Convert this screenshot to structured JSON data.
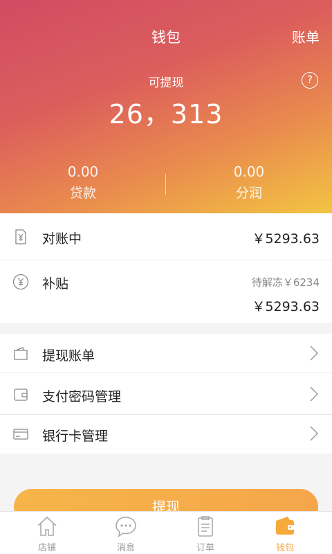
{
  "header": {
    "title": "钱包",
    "bill_link": "账单",
    "help_symbol": "?"
  },
  "balance": {
    "label": "可提现",
    "value": "26，313"
  },
  "stats": [
    {
      "value": "0.00",
      "label": "贷款"
    },
    {
      "value": "0.00",
      "label": "分润"
    }
  ],
  "reconciling": {
    "label": "对账中",
    "amount": "￥5293.63",
    "icon": "receipt-yen-icon"
  },
  "subsidy": {
    "label": "补贴",
    "frozen": "待解冻￥6234",
    "amount": "￥5293.63",
    "icon": "yen-circle-icon"
  },
  "menu": [
    {
      "label": "提现账单",
      "icon": "wallet-icon"
    },
    {
      "label": "支付密码管理",
      "icon": "wallet-card-icon"
    },
    {
      "label": "银行卡管理",
      "icon": "bank-card-icon"
    }
  ],
  "withdraw_button": "提现",
  "tabs": [
    {
      "label": "店铺",
      "icon": "store-icon",
      "active": false
    },
    {
      "label": "消息",
      "icon": "message-icon",
      "active": false
    },
    {
      "label": "订单",
      "icon": "order-icon",
      "active": false
    },
    {
      "label": "钱包",
      "icon": "wallet-icon",
      "active": true
    }
  ],
  "colors": {
    "accent": "#f6a93d",
    "hero_top": "#d24b63",
    "hero_bottom": "#f3c442"
  }
}
